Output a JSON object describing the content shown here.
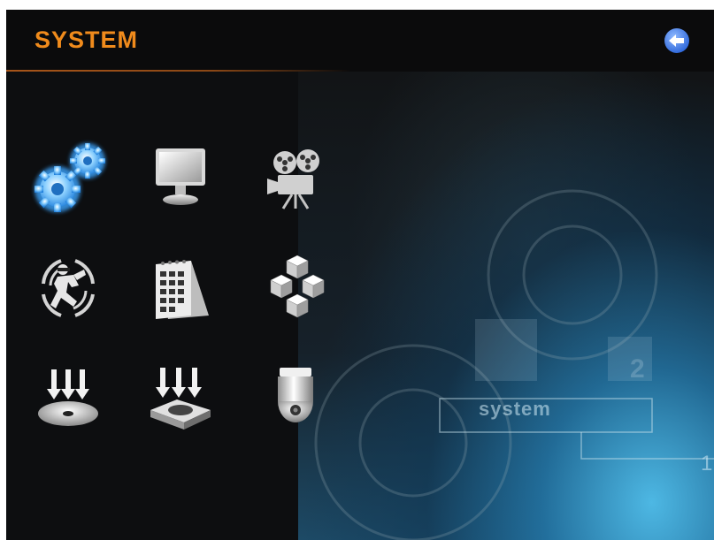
{
  "header": {
    "title": "SYSTEM",
    "back_icon": "back-arrow-icon",
    "accent_color": "#f08b1c"
  },
  "menu": {
    "items": [
      {
        "icon": "gears-icon",
        "selected": true
      },
      {
        "icon": "monitor-icon",
        "selected": false
      },
      {
        "icon": "film-camera-icon",
        "selected": false
      },
      {
        "icon": "motion-detection-icon",
        "selected": false
      },
      {
        "icon": "calendar-icon",
        "selected": false
      },
      {
        "icon": "network-cubes-icon",
        "selected": false
      },
      {
        "icon": "disc-backup-icon",
        "selected": false
      },
      {
        "icon": "hdd-backup-icon",
        "selected": false
      },
      {
        "icon": "ptz-dome-camera-icon",
        "selected": false
      }
    ]
  },
  "background": {
    "labels": [
      "system",
      "1",
      "2"
    ]
  }
}
